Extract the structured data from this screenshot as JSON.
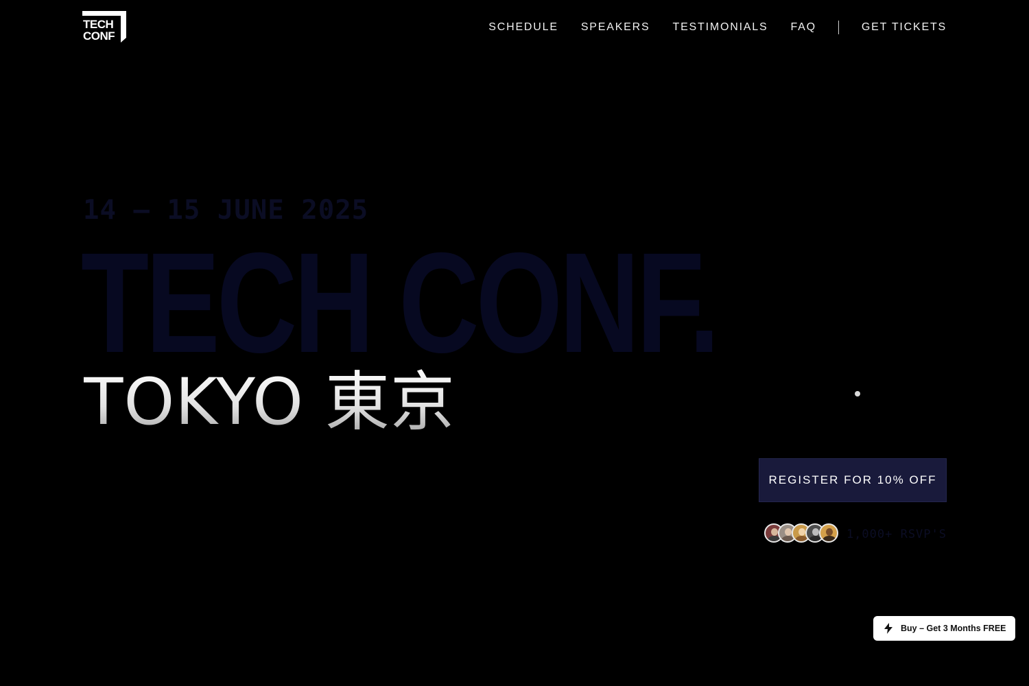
{
  "header": {
    "logo": {
      "line1": "TECH",
      "line2": "CONF",
      "icon": "tech-conf-logo"
    },
    "nav": {
      "schedule": "SCHEDULE",
      "speakers": "SPEAKERS",
      "testimonials": "TESTIMONIALS",
      "faq": "FAQ",
      "tickets": "GET TICKETS"
    }
  },
  "hero": {
    "date": "14 – 15 JUNE 2025",
    "title": "TECH CONF.",
    "city": "TOKYO 東京",
    "register_label": "REGISTER FOR 10% OFF",
    "rsvp_text": "1,000+ RSVP'S",
    "avatar_icons": [
      "avatar-1",
      "avatar-2",
      "avatar-3",
      "avatar-4",
      "avatar-5"
    ]
  },
  "promo": {
    "label": "Buy – Get 3 Months FREE",
    "icon": "lightning-bolt-icon"
  },
  "colors": {
    "background": "#000000",
    "accent": "#191a3b",
    "dim_text": "#0b0d24",
    "title_text": "#070921"
  }
}
